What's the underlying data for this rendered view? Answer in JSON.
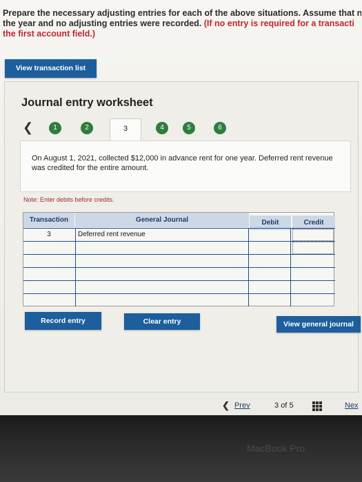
{
  "intro": {
    "line1": "Prepare the necessary adjusting entries for each of the above situations. Assume that n",
    "line2a": "the year and no adjusting entries were recorded.",
    "line2b": " (If no entry is required for a transacti",
    "line3": "the first account field.)"
  },
  "buttons": {
    "view_transaction_list": "View transaction list",
    "record_entry": "Record entry",
    "clear_entry": "Clear entry",
    "view_general_journal": "View general journal"
  },
  "worksheet": {
    "title": "Journal entry worksheet",
    "steps": [
      "1",
      "2",
      "3",
      "4",
      "5",
      "6"
    ],
    "active_step": "3",
    "description": "On August 1, 2021, collected $12,000 in advance rent for one year. Deferred rent revenue was credited for the entire amount.",
    "note": "Note: Enter debits before credits."
  },
  "journal": {
    "headers": {
      "transaction": "Transaction",
      "general_journal": "General Journal",
      "debit": "Debit",
      "credit": "Credit"
    },
    "rows": [
      {
        "transaction": "3",
        "account": "Deferred rent revenue",
        "debit": "",
        "credit": ""
      },
      {
        "transaction": "",
        "account": "",
        "debit": "",
        "credit": ""
      },
      {
        "transaction": "",
        "account": "",
        "debit": "",
        "credit": ""
      },
      {
        "transaction": "",
        "account": "",
        "debit": "",
        "credit": ""
      },
      {
        "transaction": "",
        "account": "",
        "debit": "",
        "credit": ""
      },
      {
        "transaction": "",
        "account": "",
        "debit": "",
        "credit": ""
      }
    ]
  },
  "pager": {
    "prev": "Prev",
    "current": "3",
    "of_label": "of",
    "total": "5",
    "next": "Nex"
  },
  "bezel": {
    "label": "MacBook Pro"
  },
  "colors": {
    "button_blue": "#1d5e9c",
    "step_green": "#2f7d3e",
    "instruction_red": "#c0262c"
  }
}
